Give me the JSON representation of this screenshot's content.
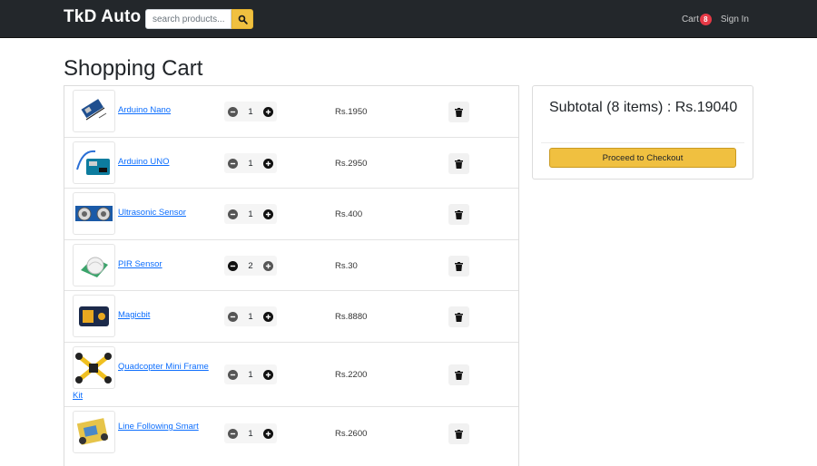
{
  "navbar": {
    "brand": "TkD Auto",
    "search_placeholder": "search products...",
    "cart_label": "Cart",
    "cart_count": "8",
    "signin_label": "Sign In"
  },
  "page": {
    "title": "Shopping Cart"
  },
  "cart": {
    "items": [
      {
        "name": "Arduino Nano",
        "qty": "1",
        "price": "Rs.1950"
      },
      {
        "name": "Arduino UNO",
        "qty": "1",
        "price": "Rs.2950"
      },
      {
        "name": "Ultrasonic Sensor",
        "qty": "1",
        "price": "Rs.400"
      },
      {
        "name": "PIR Sensor",
        "qty": "2",
        "price": "Rs.30"
      },
      {
        "name": "Magicbit",
        "qty": "1",
        "price": "Rs.8880"
      },
      {
        "name_line1": "Quadcopter Mini Frame",
        "name_line2": "Kit",
        "qty": "1",
        "price": "Rs.2200"
      },
      {
        "name": "Line Following Smart",
        "qty": "1",
        "price": "Rs.2600"
      }
    ]
  },
  "summary": {
    "subtotal": "Subtotal (8 items) : Rs.19040",
    "checkout_label": "Proceed to Checkout"
  },
  "colors": {
    "navbar": "#23272b",
    "accent": "#f0c040",
    "badge": "#e63946",
    "link": "#0d6efd"
  }
}
